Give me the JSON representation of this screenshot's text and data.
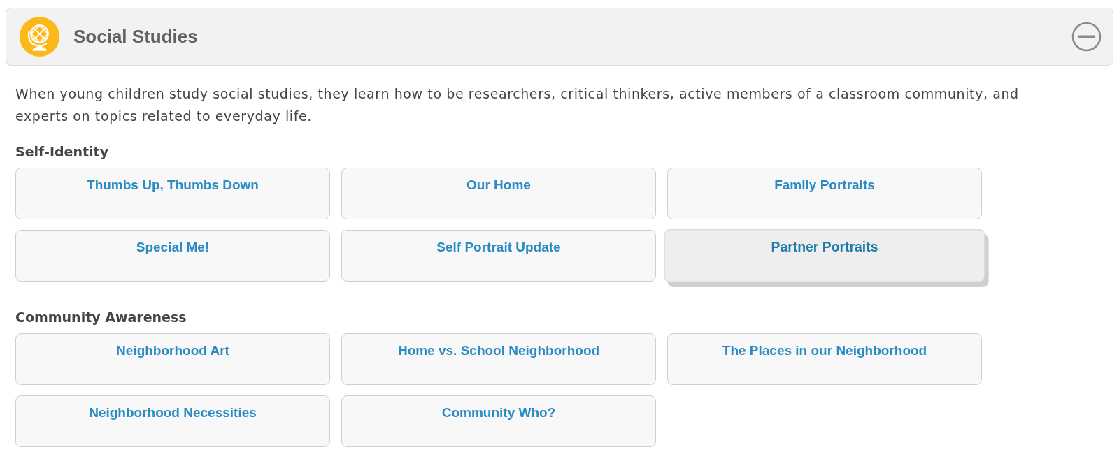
{
  "header": {
    "title": "Social Studies",
    "expanded": true
  },
  "description": "When young children study social studies, they learn how to be researchers, critical thinkers, active members of a classroom community, and experts on topics related to everyday life.",
  "sections": [
    {
      "heading": "Self-Identity",
      "activities": [
        {
          "label": "Thumbs Up, Thumbs Down",
          "hovered": false
        },
        {
          "label": "Our Home",
          "hovered": false
        },
        {
          "label": "Family Portraits",
          "hovered": false
        },
        {
          "label": "Special Me!",
          "hovered": false
        },
        {
          "label": "Self Portrait Update",
          "hovered": false
        },
        {
          "label": "Partner Portraits",
          "hovered": true
        }
      ]
    },
    {
      "heading": "Community Awareness",
      "activities": [
        {
          "label": "Neighborhood Art",
          "hovered": false
        },
        {
          "label": "Home vs. School Neighborhood",
          "hovered": false
        },
        {
          "label": "The Places in our Neighborhood",
          "hovered": false
        },
        {
          "label": "Neighborhood Necessities",
          "hovered": false
        },
        {
          "label": "Community Who?",
          "hovered": false
        }
      ]
    }
  ]
}
